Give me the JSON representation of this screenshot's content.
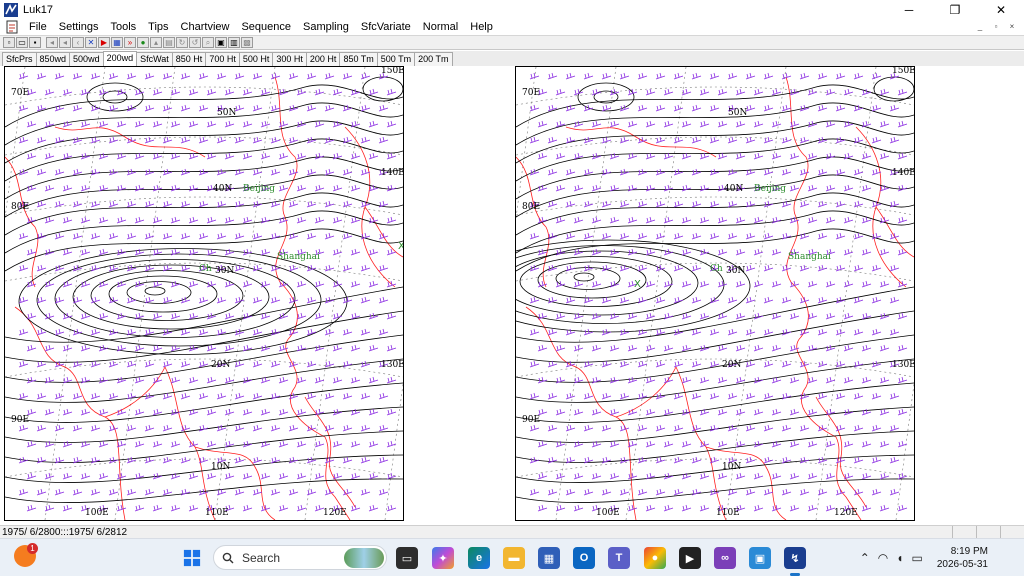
{
  "window": {
    "title": "Luk17",
    "minimize": "─",
    "restore": "❐",
    "close": "✕"
  },
  "menu": {
    "items": [
      "File",
      "Settings",
      "Tools",
      "Tips",
      "Chartview",
      "Sequence",
      "Sampling",
      "SfcVariate",
      "Normal",
      "Help"
    ],
    "mdi": [
      "_",
      "▫",
      "×"
    ]
  },
  "tabs": {
    "items": [
      "SfcPrs",
      "850wd",
      "500wd",
      "200wd",
      "SfcWat",
      "850 Ht",
      "700 Ht",
      "500 Ht",
      "300 Ht",
      "200 Ht",
      "850 Tm",
      "500 Tm",
      "200 Tm"
    ],
    "active_index": 3
  },
  "maps": {
    "left": {
      "lat_labels": [
        "50N",
        "40N",
        "30N",
        "20N",
        "10N"
      ],
      "lon_labels": [
        "70E",
        "80E",
        "90E",
        "100E",
        "110E",
        "120E",
        "130E",
        "140E",
        "150E"
      ],
      "city_labels": [
        "Beijing",
        "Shanghai",
        "Ch"
      ],
      "markers": [
        "X"
      ]
    },
    "right": {
      "lat_labels": [
        "50N",
        "40N",
        "30N",
        "20N",
        "10N"
      ],
      "lon_labels": [
        "70E",
        "80E",
        "90E",
        "100E",
        "110E",
        "120E",
        "130E",
        "140E",
        "150E"
      ],
      "city_labels": [
        "Beijing",
        "Shanghai",
        "Ch"
      ],
      "markers": [
        "X"
      ]
    },
    "colors": {
      "contour": "#000000",
      "wind_barb": "#8a2be2",
      "coastline": "#ff2020",
      "graticule": "#7a7a7a",
      "city": "#2a8a2a"
    }
  },
  "status": {
    "text": "1975/ 6/2800:::1975/ 6/2812"
  },
  "taskbar": {
    "widget_badge": "1",
    "search_label": "Search",
    "clock_time": "8:19 PM",
    "clock_date": "2026-05-31"
  }
}
